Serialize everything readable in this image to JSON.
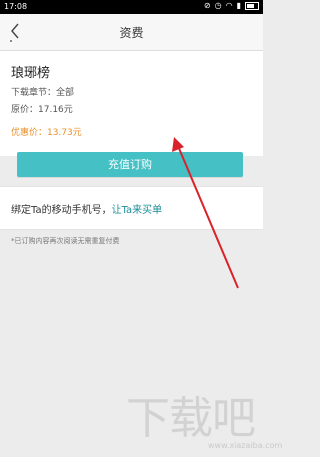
{
  "status_bar": {
    "time": "17:08"
  },
  "nav": {
    "title": "资费"
  },
  "product": {
    "name": "琅琊榜",
    "chapters": "下载章节：全部",
    "original_price": "原价：17.16元",
    "discount_price": "优惠价：13.73元"
  },
  "actions": {
    "pay_button": "充值订购"
  },
  "bind": {
    "prefix": "绑定Ta的移动手机号，",
    "link": "让Ta来买单"
  },
  "note": "*已订购内容再次阅读无需重复付费",
  "watermark": {
    "text": "下载吧",
    "url": "www.xiazaiba.com"
  },
  "colors": {
    "accent": "#45c0c4",
    "discount": "#e8902c",
    "link": "#1d8e98",
    "annotation_arrow": "#d9222a"
  }
}
